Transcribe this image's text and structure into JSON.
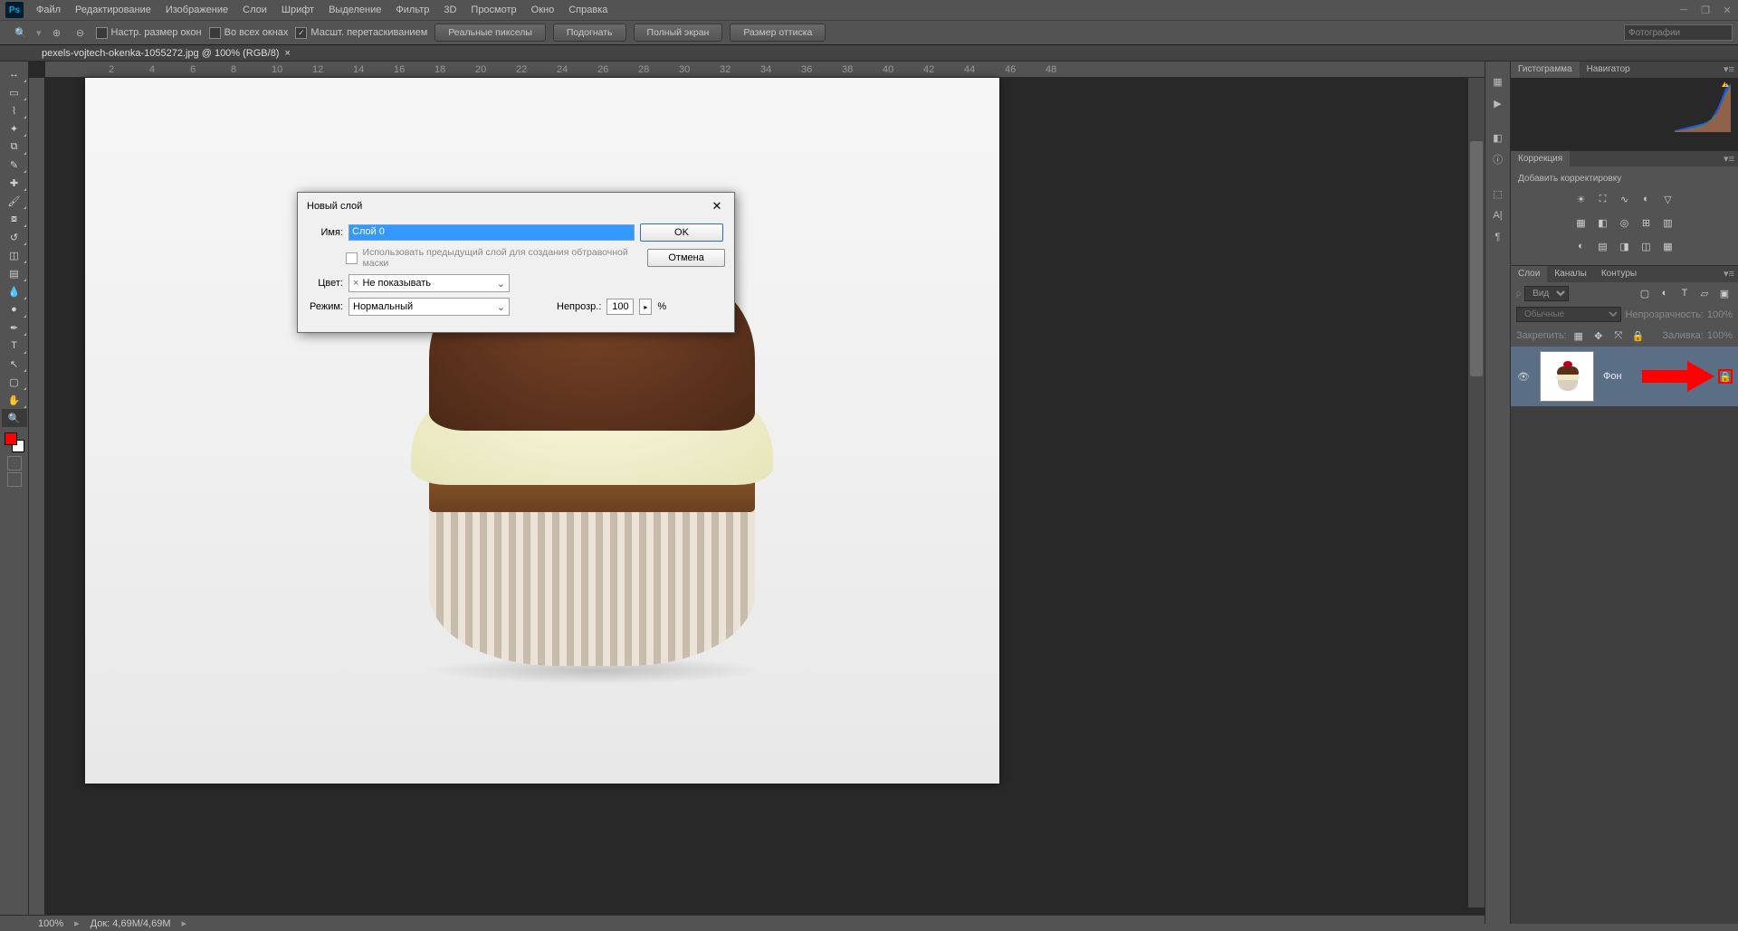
{
  "menus": [
    "Файл",
    "Редактирование",
    "Изображение",
    "Слои",
    "Шрифт",
    "Выделение",
    "Фильтр",
    "3D",
    "Просмотр",
    "Окно",
    "Справка"
  ],
  "options": {
    "ck1": "Настр. размер окон",
    "ck2": "Во всех окнах",
    "ck3": "Масшт. перетаскиванием",
    "btn1": "Реальные пикселы",
    "btn2": "Подогнать",
    "btn3": "Полный экран",
    "btn4": "Размер оттиска",
    "search_ph": "Фотографии"
  },
  "doc_tab": "pexels-vojtech-okenka-1055272.jpg @ 100% (RGB/8)",
  "ruler_ticks": [
    "2",
    "4",
    "6",
    "8",
    "10",
    "12",
    "14",
    "16",
    "18",
    "20",
    "22",
    "24",
    "26",
    "28",
    "30",
    "32",
    "34",
    "36",
    "38",
    "40",
    "42",
    "44",
    "46",
    "48"
  ],
  "tools": [
    "move",
    "rect-marquee",
    "lasso",
    "magic-wand",
    "crop",
    "eyedropper",
    "heal",
    "brush",
    "stamp",
    "history-brush",
    "eraser",
    "gradient",
    "blur",
    "dodge",
    "pen",
    "type",
    "path-select",
    "rectangle",
    "hand",
    "zoom"
  ],
  "panels": {
    "hist_tab": "Гистограмма",
    "nav_tab": "Навигатор",
    "corr_tab": "Коррекция",
    "corr_add": "Добавить корректировку",
    "layers_tab": "Слои",
    "channels_tab": "Каналы",
    "paths_tab": "Контуры"
  },
  "layers": {
    "kind_lbl": "Вид",
    "blend": "Обычные",
    "opacity_lbl": "Непрозрачность:",
    "opacity_val": "100%",
    "lock_lbl": "Закрепить:",
    "fill_lbl": "Заливка:",
    "fill_val": "100%",
    "layer_name": "Фон"
  },
  "dialog": {
    "title": "Новый слой",
    "name_lbl": "Имя:",
    "name_val": "Слой 0",
    "clip": "Использовать предыдущий слой для создания обтравочной маски",
    "color_lbl": "Цвет:",
    "color_val": "Не показывать",
    "mode_lbl": "Режим:",
    "mode_val": "Нормальный",
    "opac_lbl": "Непрозр.:",
    "opac_val": "100",
    "pct": "%",
    "ok": "OK",
    "cancel": "Отмена"
  },
  "status": {
    "zoom": "100%",
    "doc": "Док: 4,69M/4,69M"
  }
}
